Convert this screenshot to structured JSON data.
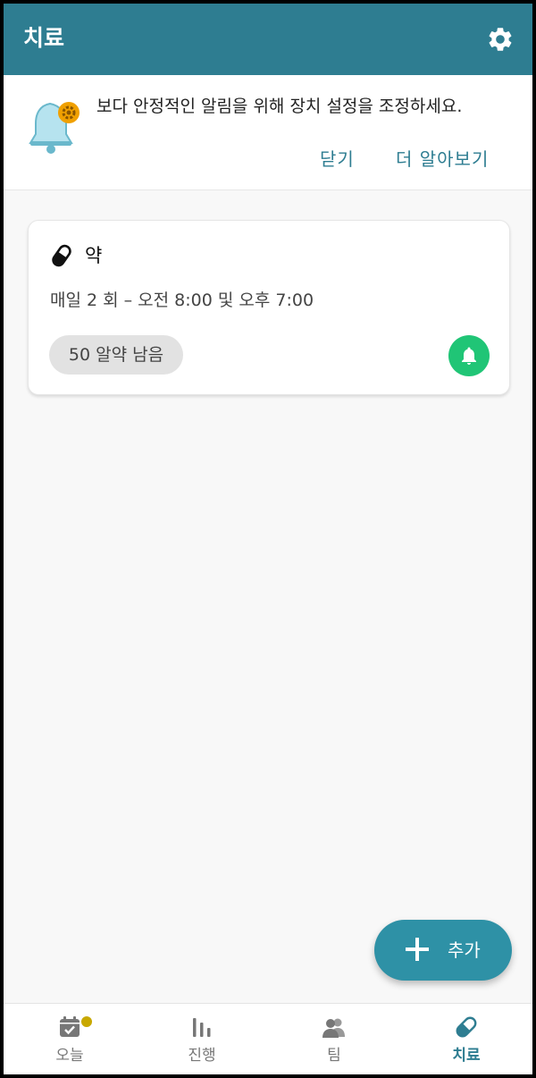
{
  "appbar": {
    "title": "치료",
    "settings_icon": "gear-icon"
  },
  "banner": {
    "message": "보다 안정적인 알림을 위해 장치 설정을 조정하세요.",
    "close_label": "닫기",
    "learn_more_label": "더 알아보기"
  },
  "medication": {
    "name": "약",
    "schedule": "매일 2 회 – 오전 8:00 및 오후 7:00",
    "remaining": "50 알약 남음",
    "icon": "pill-icon",
    "reminder_color": "#20c576"
  },
  "fab": {
    "label": "추가"
  },
  "nav": {
    "items": [
      {
        "label": "오늘",
        "icon": "calendar-check-icon"
      },
      {
        "label": "진행",
        "icon": "bar-chart-icon"
      },
      {
        "label": "팀",
        "icon": "people-icon"
      },
      {
        "label": "치료",
        "icon": "pill-icon"
      }
    ],
    "active": "치료"
  },
  "colors": {
    "primary": "#2e7d91",
    "fab": "#2e91a6",
    "accent_dot": "#c8a800"
  }
}
